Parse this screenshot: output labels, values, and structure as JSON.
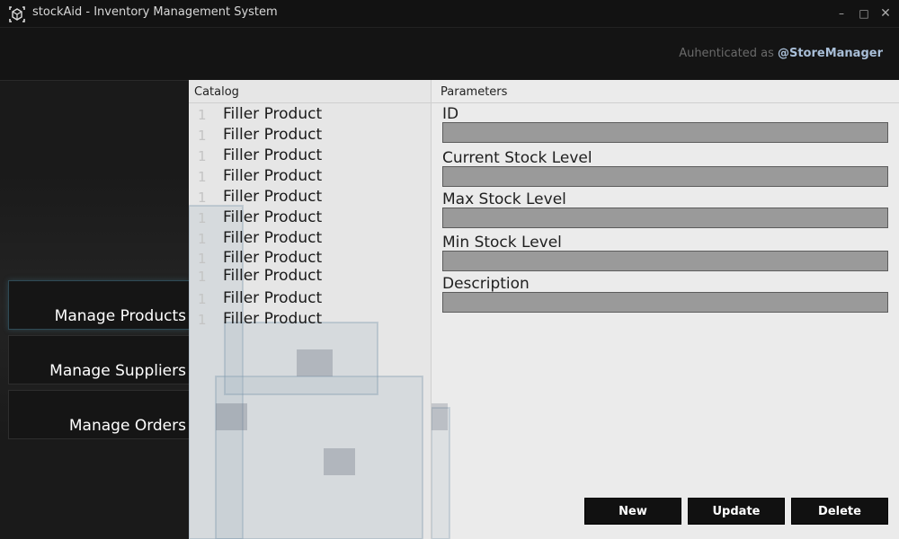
{
  "window": {
    "title": "stockAid - Inventory Management System",
    "icon": "box-logo-icon",
    "controls": {
      "minimize": "–",
      "maximize": "□",
      "close": "✕"
    }
  },
  "header": {
    "auth_label": "Auhenticated as ",
    "auth_user": "@StoreManager"
  },
  "sidebar": {
    "items": [
      {
        "label": "Manage Products",
        "active": true
      },
      {
        "label": "Manage Suppliers",
        "active": false
      },
      {
        "label": "Manage Orders",
        "active": false
      }
    ]
  },
  "catalog": {
    "title": "Catalog",
    "rows": [
      {
        "num": "1",
        "name": "Filler Product"
      },
      {
        "num": "1",
        "name": "Filler Product"
      },
      {
        "num": "1",
        "name": "Filler Product"
      },
      {
        "num": "1",
        "name": "Filler Product"
      },
      {
        "num": "1",
        "name": "Filler Product"
      },
      {
        "num": "1",
        "name": "Filler Product"
      },
      {
        "num": "1",
        "name": "Filler Product"
      },
      {
        "num": "1",
        "name": "Filler Product"
      },
      {
        "num": "1",
        "name": "Filler Product"
      },
      {
        "num": "1",
        "name": "Filler Product"
      },
      {
        "num": "1",
        "name": "Filler Product"
      }
    ]
  },
  "parameters": {
    "title": "Parameters",
    "fields": [
      {
        "label": "ID",
        "value": ""
      },
      {
        "label": "Current Stock Level",
        "value": ""
      },
      {
        "label": "Max Stock Level",
        "value": ""
      },
      {
        "label": "Min Stock Level",
        "value": ""
      },
      {
        "label": "Description",
        "value": ""
      }
    ]
  },
  "actions": {
    "new": "New",
    "update": "Update",
    "delete": "Delete"
  },
  "colors": {
    "accent": "#a9bfd8",
    "field_bg": "#9a9a9a",
    "button_bg": "#111111"
  }
}
